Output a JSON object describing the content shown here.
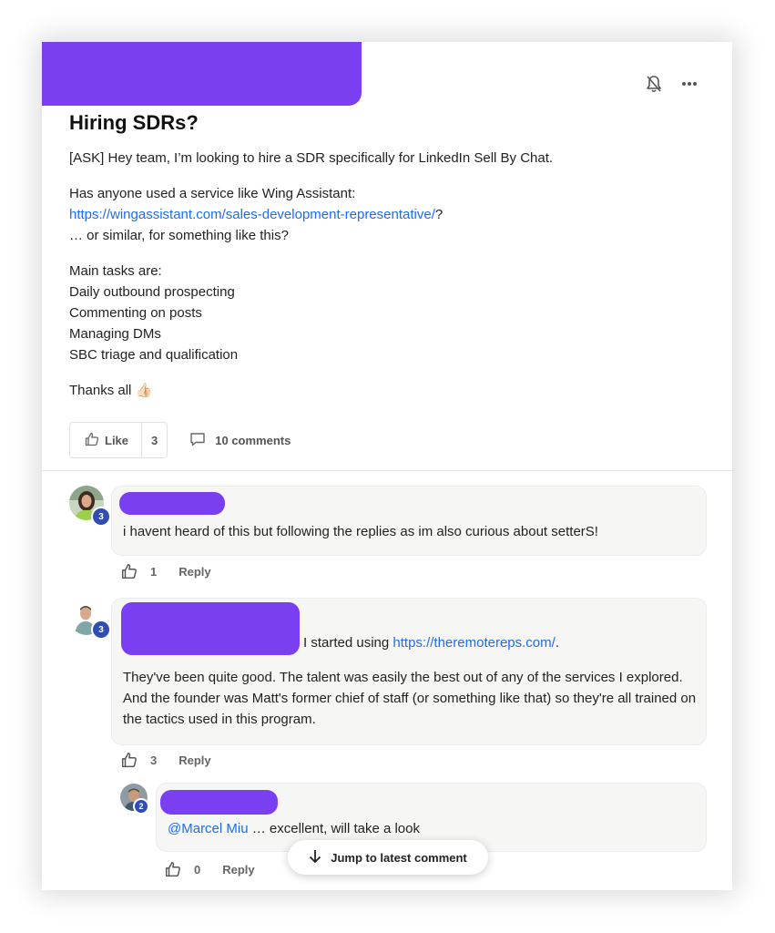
{
  "post": {
    "title": "Hiring SDRs?",
    "paragraph1": "[ASK] Hey team, I’m looking to hire a SDR specifically for LinkedIn Sell By Chat.",
    "paragraph2_line1": "Has anyone used a service like Wing Assistant:",
    "paragraph2_link": "https://wingassistant.com/sales-development-representative/",
    "paragraph2_link_suffix": "?",
    "paragraph2_line3": "… or similar, for something like this?",
    "tasks_heading": "Main tasks are:",
    "tasks": [
      "Daily outbound prospecting",
      "Commenting on posts",
      "Managing DMs",
      "SBC triage and qualification"
    ],
    "thanks": "Thanks all",
    "thanks_emoji": "👍🏻",
    "like_label": "Like",
    "like_count": "3",
    "comments_label": "10 comments"
  },
  "comments": [
    {
      "level_badge": "3",
      "text": "i havent heard of this but following the replies as im also curious about setterS!",
      "likes": "1",
      "reply_label": "Reply"
    },
    {
      "level_badge": "3",
      "intro": "I started using ",
      "link": "https://theremotereps.com/",
      "intro_suffix": ".",
      "text": "They've been quite good. The talent was easily the best out of any of the services I explored. And the founder was Matt's former chief of staff (or something like that) so they're all trained on the tactics used in this program.",
      "likes": "3",
      "reply_label": "Reply"
    },
    {
      "level_badge": "2",
      "mention": "@Marcel Miu",
      "text": " … excellent, will take a look",
      "likes": "0",
      "reply_label": "Reply"
    }
  ],
  "jump_label": "Jump to latest comment",
  "icons": {
    "bell": "bell-off-icon",
    "more": "more-horizontal-icon",
    "like": "thumbs-up-icon",
    "comment": "comment-icon",
    "arrow": "arrow-down-icon"
  },
  "colors": {
    "redaction": "#7b3ff2",
    "link": "#1a6ef5",
    "badge": "#2f4db3",
    "bubble": "#f6f6f4"
  }
}
